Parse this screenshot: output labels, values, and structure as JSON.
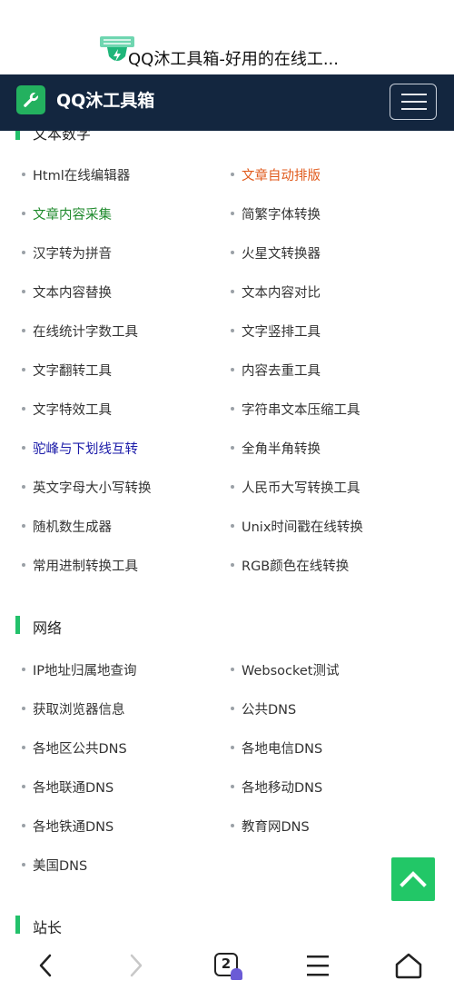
{
  "browser": {
    "page_title": "QQ沐工具箱-好用的在线工...",
    "tab_count": "2"
  },
  "header": {
    "site_name": "QQ沐工具箱"
  },
  "sections": [
    {
      "title": "文本数字",
      "items": [
        {
          "label": "Html在线编辑器",
          "color": "normal"
        },
        {
          "label": "文章自动排版",
          "color": "orange"
        },
        {
          "label": "文章内容采集",
          "color": "green"
        },
        {
          "label": "简繁字体转换",
          "color": "normal"
        },
        {
          "label": "汉字转为拼音",
          "color": "normal"
        },
        {
          "label": "火星文转换器",
          "color": "normal"
        },
        {
          "label": "文本内容替换",
          "color": "normal"
        },
        {
          "label": "文本内容对比",
          "color": "normal"
        },
        {
          "label": "在线统计字数工具",
          "color": "normal"
        },
        {
          "label": "文字竖排工具",
          "color": "normal"
        },
        {
          "label": "文字翻转工具",
          "color": "normal"
        },
        {
          "label": "内容去重工具",
          "color": "normal"
        },
        {
          "label": "文字特效工具",
          "color": "normal"
        },
        {
          "label": "字符串文本压缩工具",
          "color": "normal"
        },
        {
          "label": "驼峰与下划线互转",
          "color": "blue"
        },
        {
          "label": "全角半角转换",
          "color": "normal"
        },
        {
          "label": "英文字母大小写转换",
          "color": "normal"
        },
        {
          "label": "人民币大写转换工具",
          "color": "normal"
        },
        {
          "label": "随机数生成器",
          "color": "normal"
        },
        {
          "label": "Unix时间戳在线转换",
          "color": "normal"
        },
        {
          "label": "常用进制转换工具",
          "color": "normal"
        },
        {
          "label": "RGB颜色在线转换",
          "color": "normal"
        }
      ]
    },
    {
      "title": "网络",
      "items": [
        {
          "label": "IP地址归属地查询",
          "color": "normal"
        },
        {
          "label": "Websocket测试",
          "color": "normal"
        },
        {
          "label": "获取浏览器信息",
          "color": "normal"
        },
        {
          "label": "公共DNS",
          "color": "normal"
        },
        {
          "label": "各地区公共DNS",
          "color": "normal"
        },
        {
          "label": "各地电信DNS",
          "color": "normal"
        },
        {
          "label": "各地联通DNS",
          "color": "normal"
        },
        {
          "label": "各地移动DNS",
          "color": "normal"
        },
        {
          "label": "各地铁通DNS",
          "color": "normal"
        },
        {
          "label": "教育网DNS",
          "color": "normal"
        },
        {
          "label": "美国DNS",
          "color": "normal"
        }
      ]
    },
    {
      "title": "站长",
      "items": []
    }
  ],
  "colors": {
    "header_bg": "#13263f",
    "accent_green": "#23c16b",
    "orange": "#e05a1c",
    "green": "#1f8a2c",
    "blue": "#1a1aa8"
  },
  "icons": {
    "logo": "wrench-icon",
    "menu": "hamburger-menu-icon",
    "back_to_top": "chevron-up-icon",
    "nav_back": "chevron-left-icon",
    "nav_forward": "chevron-right-icon",
    "nav_menu": "hamburger-icon",
    "nav_home": "home-icon"
  }
}
